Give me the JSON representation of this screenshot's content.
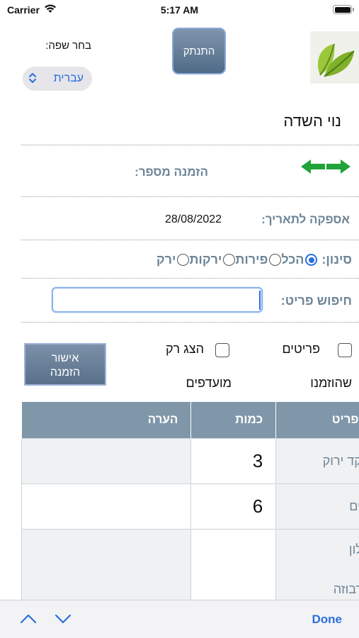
{
  "status_bar": {
    "carrier": "Carrier",
    "time": "5:17 AM"
  },
  "header": {
    "logout_label": "התנתק",
    "language_label": "בחר שפה:",
    "language_value": "עברית"
  },
  "page": {
    "title": "נוי השדה",
    "order_number_label": "הזמנה מספר:",
    "delivery_date_label": "אספקה לתאריך:",
    "delivery_date_value": "28/08/2022",
    "filter_label": "סינון:",
    "filter_options": [
      "הכל",
      "פירות",
      "ירקות",
      "ירק"
    ],
    "filter_selected": "הכל",
    "search_label": "חיפוש פריט:",
    "search_value": "",
    "checkbox_ordered_line1": "פריטים",
    "checkbox_ordered_line2": "שהוזמנו",
    "checkbox_favorites_line1": "הצג רק",
    "checkbox_favorites_line2": "מועדפים",
    "confirm_line1": "אישור",
    "confirm_line2": "הזמנה"
  },
  "table": {
    "headers": [
      "פריט",
      "כמות",
      "הערה"
    ],
    "rows": [
      {
        "item": "שקד ירוק",
        "qty": "3",
        "note": ""
      },
      {
        "item": "ליים",
        "qty": "6",
        "note": ""
      },
      {
        "item_line1": "מלון",
        "item_line2": "חרבוזה",
        "qty": "",
        "note": ""
      }
    ]
  },
  "accessory": {
    "done_label": "Done"
  },
  "colors": {
    "accent": "#2a6fdb",
    "header_bg": "#7f97a8",
    "label": "#6d8596",
    "arrows": "#1fa33a"
  }
}
